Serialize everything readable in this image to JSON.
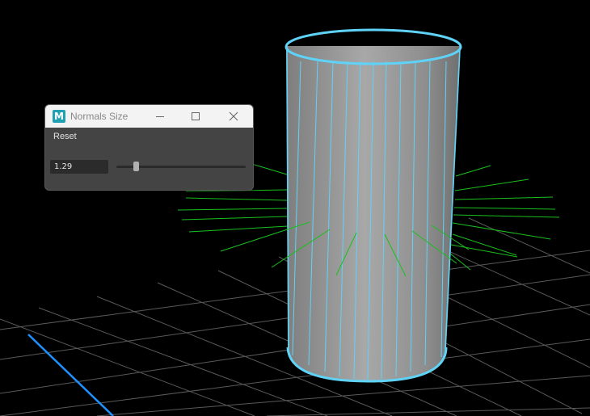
{
  "window": {
    "title": "Normals Size",
    "app_icon_letter": "M",
    "menu": {
      "reset_label": "Reset"
    }
  },
  "normals_size": {
    "value": "1.29",
    "slider_fraction": 0.15
  },
  "viewport": {
    "background": "#000000",
    "grid_color": "#5a5a5a",
    "axis_color": "#1e90ff",
    "wireframe_color": "#5fd3f7",
    "normals_color": "#19c01c",
    "surface_color": "#9a9a9a"
  },
  "icons": [
    "maya-app-icon",
    "minimize-icon",
    "maximize-icon",
    "close-icon"
  ]
}
